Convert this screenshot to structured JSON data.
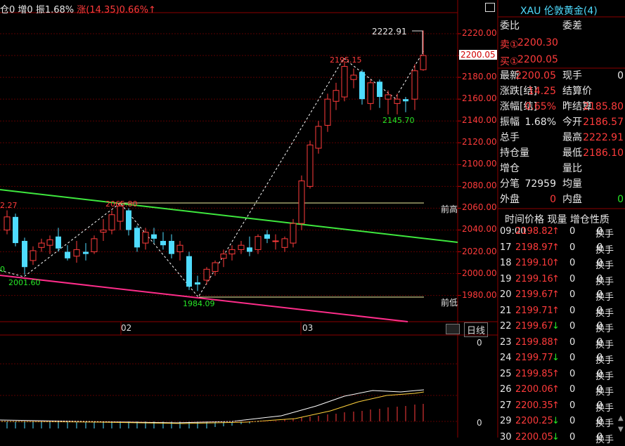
{
  "status_bar": {
    "position": "仓0",
    "increase": "增0",
    "amplitude": "振1.68%",
    "change": "涨(14.35)0.66%↑"
  },
  "chart": {
    "y_ticks": [
      "2220.00",
      "2200.00",
      "2180.00",
      "2160.00",
      "2140.00",
      "2120.00",
      "2100.00",
      "2080.00",
      "2060.00",
      "2040.00",
      "2020.00",
      "2000.00",
      "1980.00"
    ],
    "x_ticks": [
      "02",
      "03"
    ],
    "annotations": {
      "high_2222": "2222.91",
      "high_2195": "2195.15",
      "low_2145": "2145.70",
      "low_2001": "2001.60",
      "low_1984": "1984.09",
      "left_cut": "2.27",
      "mid_peak": "2065.80",
      "left_zero": "0"
    },
    "prev_high_label": "前高",
    "prev_low_label": "前低",
    "current_price_tag": "2200.05",
    "daily_button": "日线",
    "sub_zero_top": "0",
    "sub_zero_bottom": "0"
  },
  "quote_panel": {
    "title": "XAU 伦敦黄金(4)",
    "wei_bi": "委比",
    "wei_cha": "委差",
    "sell_label": "卖①",
    "sell_price": "2200.30",
    "buy_label": "买①",
    "buy_price": "2200.05",
    "rows": [
      {
        "l1": "最新",
        "v1": "2200.05",
        "l2": "现手",
        "v2": "0"
      },
      {
        "l1": "涨跌[结]",
        "v1": "14.25",
        "l2": "结算价",
        "v2": ""
      },
      {
        "l1": "涨幅[结]",
        "v1": "0.65%",
        "l2": "昨结算",
        "v2": "2185.80"
      },
      {
        "l1": "振幅",
        "v1": "1.68%",
        "l2": "今开",
        "v2": "2186.57"
      },
      {
        "l1": "总手",
        "v1": "",
        "l2": "最高",
        "v2": "2222.91"
      },
      {
        "l1": "持仓量",
        "v1": "",
        "l2": "最低",
        "v2": "2186.10"
      },
      {
        "l1": "增仓",
        "v1": "",
        "l2": "量比",
        "v2": ""
      },
      {
        "l1": "分笔",
        "v1": "72959",
        "l2": "均量",
        "v2": ""
      },
      {
        "l1": "外盘",
        "v1": "0",
        "l2": "内盘",
        "v2": "0"
      }
    ],
    "trade_header": [
      "时间",
      "价格",
      "现量",
      "增仓",
      "性质"
    ],
    "trades": [
      {
        "time": "09:00",
        "price": "2198.82",
        "dir": "↑",
        "vol": "0",
        "oi": "0",
        "nature": "换手"
      },
      {
        "time": "17",
        "price": "2198.97",
        "dir": "↑",
        "vol": "0",
        "oi": "0",
        "nature": "换手"
      },
      {
        "time": "18",
        "price": "2199.10",
        "dir": "↑",
        "vol": "0",
        "oi": "0",
        "nature": "换手"
      },
      {
        "time": "19",
        "price": "2199.16",
        "dir": "↑",
        "vol": "0",
        "oi": "0",
        "nature": "换手"
      },
      {
        "time": "20",
        "price": "2199.67",
        "dir": "↑",
        "vol": "0",
        "oi": "0",
        "nature": "换手"
      },
      {
        "time": "21",
        "price": "2199.71",
        "dir": "↑",
        "vol": "0",
        "oi": "0",
        "nature": "换手"
      },
      {
        "time": "22",
        "price": "2199.67",
        "dir": "↓",
        "vol": "0",
        "oi": "0",
        "nature": "换手"
      },
      {
        "time": "23",
        "price": "2199.88",
        "dir": "↑",
        "vol": "0",
        "oi": "0",
        "nature": "换手"
      },
      {
        "time": "24",
        "price": "2199.77",
        "dir": "↓",
        "vol": "0",
        "oi": "0",
        "nature": "换手"
      },
      {
        "time": "25",
        "price": "2199.85",
        "dir": "↑",
        "vol": "0",
        "oi": "0",
        "nature": "换手"
      },
      {
        "time": "26",
        "price": "2200.06",
        "dir": "↑",
        "vol": "0",
        "oi": "0",
        "nature": "换手"
      },
      {
        "time": "27",
        "price": "2200.35",
        "dir": "↑",
        "vol": "0",
        "oi": "0",
        "nature": "换手"
      },
      {
        "time": "29",
        "price": "2200.25",
        "dir": "↓",
        "vol": "0",
        "oi": "0",
        "nature": "换手"
      },
      {
        "time": "30",
        "price": "2200.05",
        "dir": "↓",
        "vol": "0",
        "oi": "0",
        "nature": "换手"
      }
    ]
  },
  "colors": {
    "up": "#ff3b3b",
    "down": "#4fdcff",
    "green_trend": "#3ee83e",
    "magenta_trend": "#ff2d8a",
    "grid": "#5a0000",
    "axis": "#8b0000"
  }
}
